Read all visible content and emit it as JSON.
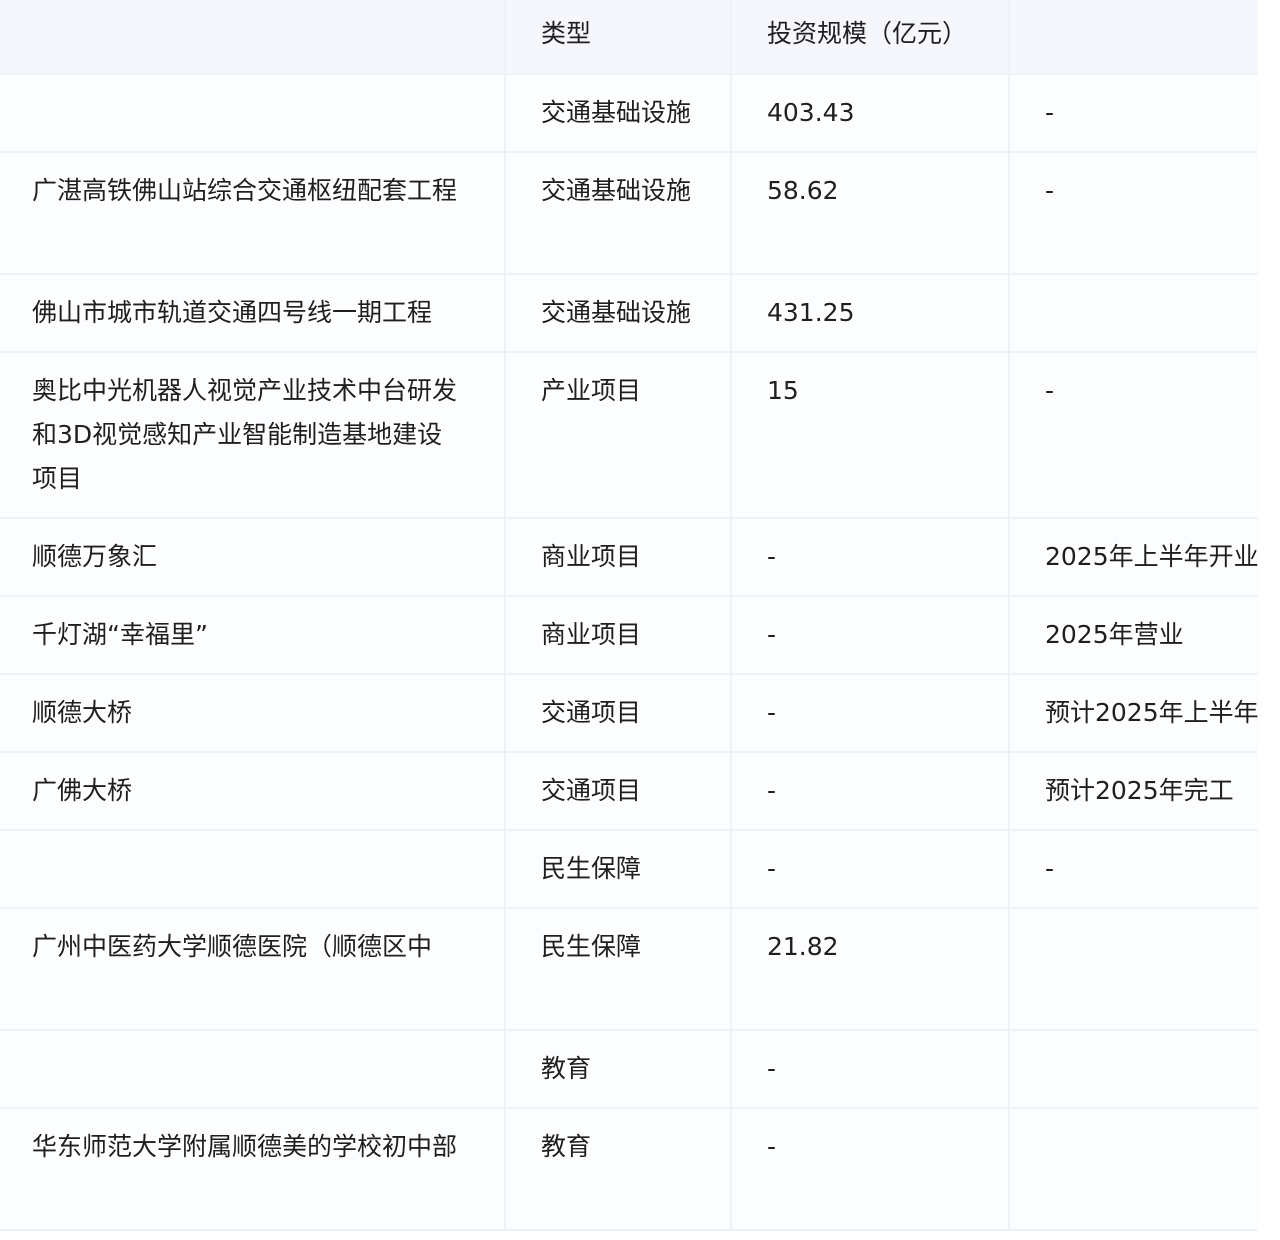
{
  "table": {
    "headers": {
      "name": "",
      "type": "类型",
      "investment": "投资规模（亿元）",
      "note": ""
    },
    "rows": [
      {
        "name": "",
        "type": "交通基础设施",
        "investment": "403.43",
        "note": "-"
      },
      {
        "name": "广湛高铁佛山站综合交通枢纽配套工程",
        "type": "交通基础设施",
        "investment": "58.62",
        "note": "-"
      },
      {
        "name": "佛山市城市轨道交通四号线一期工程",
        "type": "交通基础设施",
        "investment": "431.25",
        "note": ""
      },
      {
        "name": "奥比中光机器人视觉产业技术中台研发和3D视觉感知产业智能制造基地建设项目",
        "type": "产业项目",
        "investment": "15",
        "note": "-"
      },
      {
        "name": "顺德万象汇",
        "type": "商业项目",
        "investment": "-",
        "note": "2025年上半年开业"
      },
      {
        "name": "千灯湖“幸福里”",
        "type": "商业项目",
        "investment": "-",
        "note": "2025年营业"
      },
      {
        "name": "顺德大桥",
        "type": "交通项目",
        "investment": "-",
        "note": "预计2025年上半年"
      },
      {
        "name": "广佛大桥",
        "type": "交通项目",
        "investment": "-",
        "note": "预计2025年完工"
      },
      {
        "name": "",
        "type": "民生保障",
        "investment": "-",
        "note": "-"
      },
      {
        "name": "广州中医药大学顺德医院（顺德区中",
        "type": "民生保障",
        "investment": "21.82",
        "note": ""
      },
      {
        "name": "",
        "type": "教育",
        "investment": "-",
        "note": ""
      },
      {
        "name": "华东师范大学附属顺德美的学校初中部",
        "type": "教育",
        "investment": "-",
        "note": ""
      }
    ]
  }
}
